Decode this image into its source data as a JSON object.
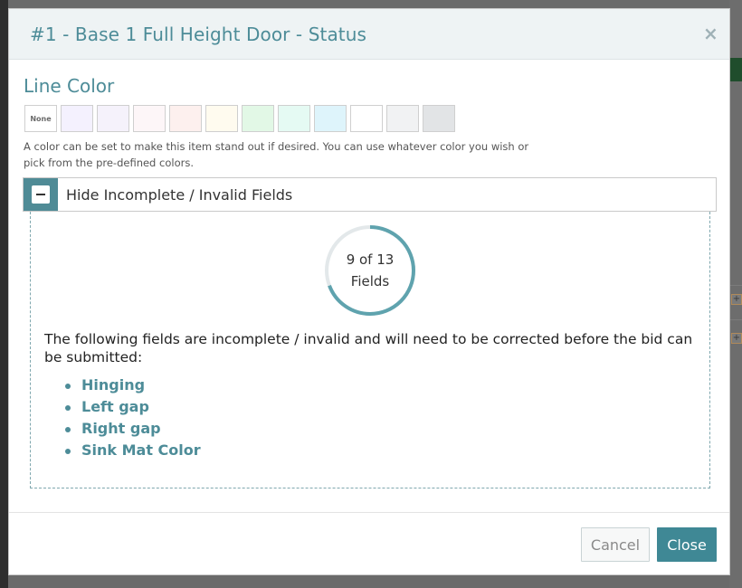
{
  "modal": {
    "title": "#1 - Base 1 Full Height Door - Status",
    "close_icon": "close-icon"
  },
  "line_color": {
    "title": "Line Color",
    "none_label": "None",
    "swatches": [
      "#f4f1fe",
      "#f5f2fb",
      "#fdf6f8",
      "#fdf0ee",
      "#fffbef",
      "#e2f8e6",
      "#e5faf3",
      "#def4fb",
      "#ffffff",
      "#f1f2f3",
      "#e2e4e6"
    ],
    "hint": "A color can be set to make this item stand out if desired. You can use whatever color you wish or pick from the pre-defined colors."
  },
  "collapse": {
    "label": "Hide Incomplete / Invalid Fields",
    "toggle_icon": "minus-icon"
  },
  "progress": {
    "completed": 9,
    "total": 13,
    "line1": "9 of 13",
    "line2": "Fields"
  },
  "issues": {
    "message": "The following fields are incomplete / invalid and will need to be corrected before the bid can be submitted:",
    "items": [
      "Hinging",
      "Left gap",
      "Right gap",
      "Sink Mat Color"
    ]
  },
  "buttons": {
    "cancel": "Cancel",
    "close": "Close"
  },
  "colors": {
    "accent": "#4d8c98",
    "primary_button": "#3f8895",
    "ring_track": "#e3e8ea"
  }
}
